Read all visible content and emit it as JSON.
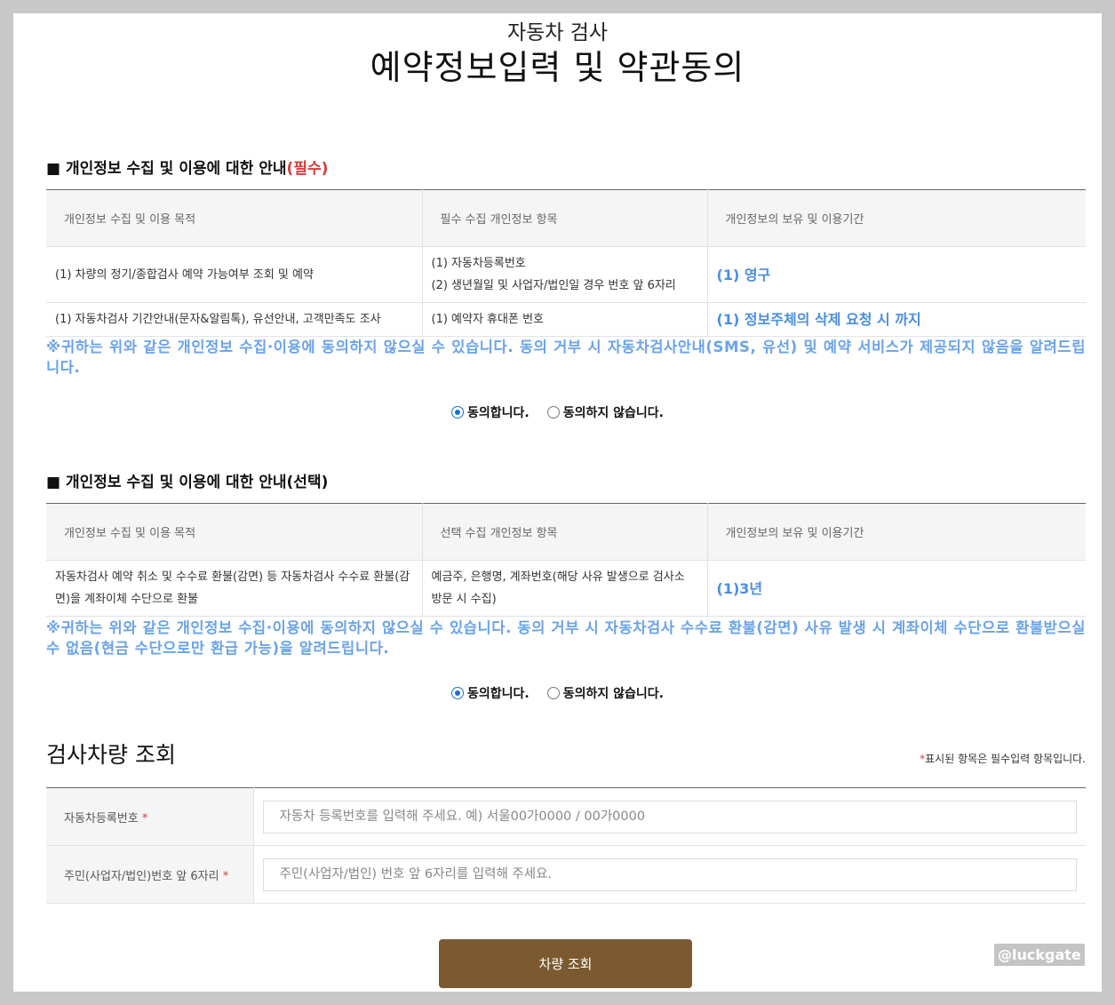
{
  "header": {
    "subtitle": "자동차 검사",
    "title": "예약정보입력 및 약관동의"
  },
  "section1": {
    "heading": "■ 개인정보 수집 및 이용에 대한 안내",
    "heading_tag": "(필수)",
    "columns": [
      "개인정보 수집 및 이용 목적",
      "필수 수집 개인정보 항목",
      "개인정보의 보유 및 이용기간"
    ],
    "rows": [
      {
        "purpose": "(1) 차량의 정기/종합검사 예약 가능여부 조회 및 예약",
        "items_line1": "(1) 자동차등록번호",
        "items_line2": "(2) 생년월일 및 사업자/법인일 경우 번호 앞 6자리",
        "period": "(1) 영구"
      },
      {
        "purpose": "(1) 자동차검사 기간안내(문자&알림톡), 유선안내, 고객만족도 조사",
        "items_line1": "(1) 예약자 휴대폰 번호",
        "period": "(1) 정보주체의 삭제 요청 시 까지"
      }
    ],
    "notice": "※귀하는 위와 같은 개인정보 수집·이용에 동의하지 않으실 수 있습니다. 동의 거부 시 자동차검사안내(SMS, 유선) 및 예약 서비스가 제공되지 않음을 알려드립니다.",
    "agree_label": "동의합니다.",
    "disagree_label": "동의하지 않습니다."
  },
  "section2": {
    "heading": "■ 개인정보 수집 및 이용에 대한 안내(선택)",
    "columns": [
      "개인정보 수집 및 이용 목적",
      "선택 수집 개인정보 항목",
      "개인정보의 보유 및 이용기간"
    ],
    "rows": [
      {
        "purpose": "자동차검사 예약 취소 및 수수료 환불(감면) 등 자동차검사 수수료 환불(감면)을 계좌이체 수단으로 환불",
        "items": "예금주, 은행명, 계좌번호(해당 사유 발생으로 검사소 방문 시 수집)",
        "period": "(1)3년"
      }
    ],
    "notice": "※귀하는 위와 같은 개인정보 수집·이용에 동의하지 않으실 수 있습니다. 동의 거부 시 자동차검사 수수료 환불(감면) 사유 발생 시 계좌이체 수단으로 환불받으실 수 없음(현금 수단으로만 환급 가능)을 알려드립니다.",
    "agree_label": "동의합니다.",
    "disagree_label": "동의하지 않습니다."
  },
  "lookup": {
    "title": "검사차량 조회",
    "req_star": "*",
    "req_note": "표시된 항목은 필수입력 항목입니다.",
    "fields": [
      {
        "label": "자동차등록번호",
        "star": "*",
        "placeholder": "자동차 등록번호를 입력해 주세요. 예) 서울00가0000 / 00가0000",
        "value": ""
      },
      {
        "label": "주민(사업자/법인)번호 앞 6자리",
        "star": "*",
        "placeholder": "주민(사업자/법인) 번호 앞 6자리를 입력해 주세요.",
        "value": ""
      }
    ],
    "submit_label": "차량 조회"
  },
  "watermark": "@luckgate",
  "colors": {
    "accent_blue": "#4a8ee0",
    "notice_blue": "#6aa3e8",
    "required_red": "#d43c3c",
    "button_brown": "#7b5a31"
  }
}
